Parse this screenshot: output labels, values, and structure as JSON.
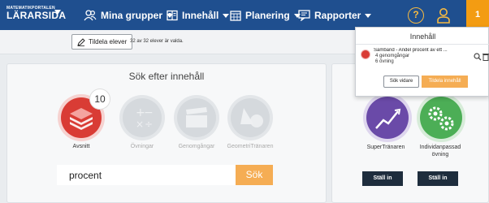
{
  "nav": {
    "logo_small": "MATEMATIKPORTALEN",
    "logo_big": "LÄRARSIDA",
    "items": [
      {
        "label": "Mina grupper",
        "icon": "groups-icon"
      },
      {
        "label": "Innehåll",
        "icon": "book-icon"
      },
      {
        "label": "Planering",
        "icon": "calendar-icon"
      },
      {
        "label": "Rapporter",
        "icon": "report-icon"
      }
    ],
    "help_label": "?",
    "badge_label": "1",
    "brand_color": "#1f4f8f"
  },
  "assign": {
    "button_label": "Tildela elever",
    "note": "32 av 32 elever är valda."
  },
  "search": {
    "heading": "Sök efter innehåll",
    "count": "10",
    "types": [
      {
        "label": "Avsnitt",
        "active": true
      },
      {
        "label": "Övningar",
        "active": false
      },
      {
        "label": "Genomgångar",
        "active": false
      },
      {
        "label": "GeometriTränaren",
        "active": false
      }
    ],
    "query": "procent",
    "button_label": "Sök",
    "accent_color": "#f5ad54"
  },
  "tools": [
    {
      "name": "SuperTränaren",
      "button_label": "Ställ in"
    },
    {
      "name": "Individanpassad övning",
      "button_label": "Ställ in"
    }
  ],
  "popup": {
    "title": "Innehåll",
    "item": {
      "title": "Samband - Andel procent av ett ...",
      "line1": "4 genomgångar",
      "line2": "6 övning"
    },
    "btn_search_more": "Sök vidare",
    "btn_assign": "Tildela innehåll"
  }
}
